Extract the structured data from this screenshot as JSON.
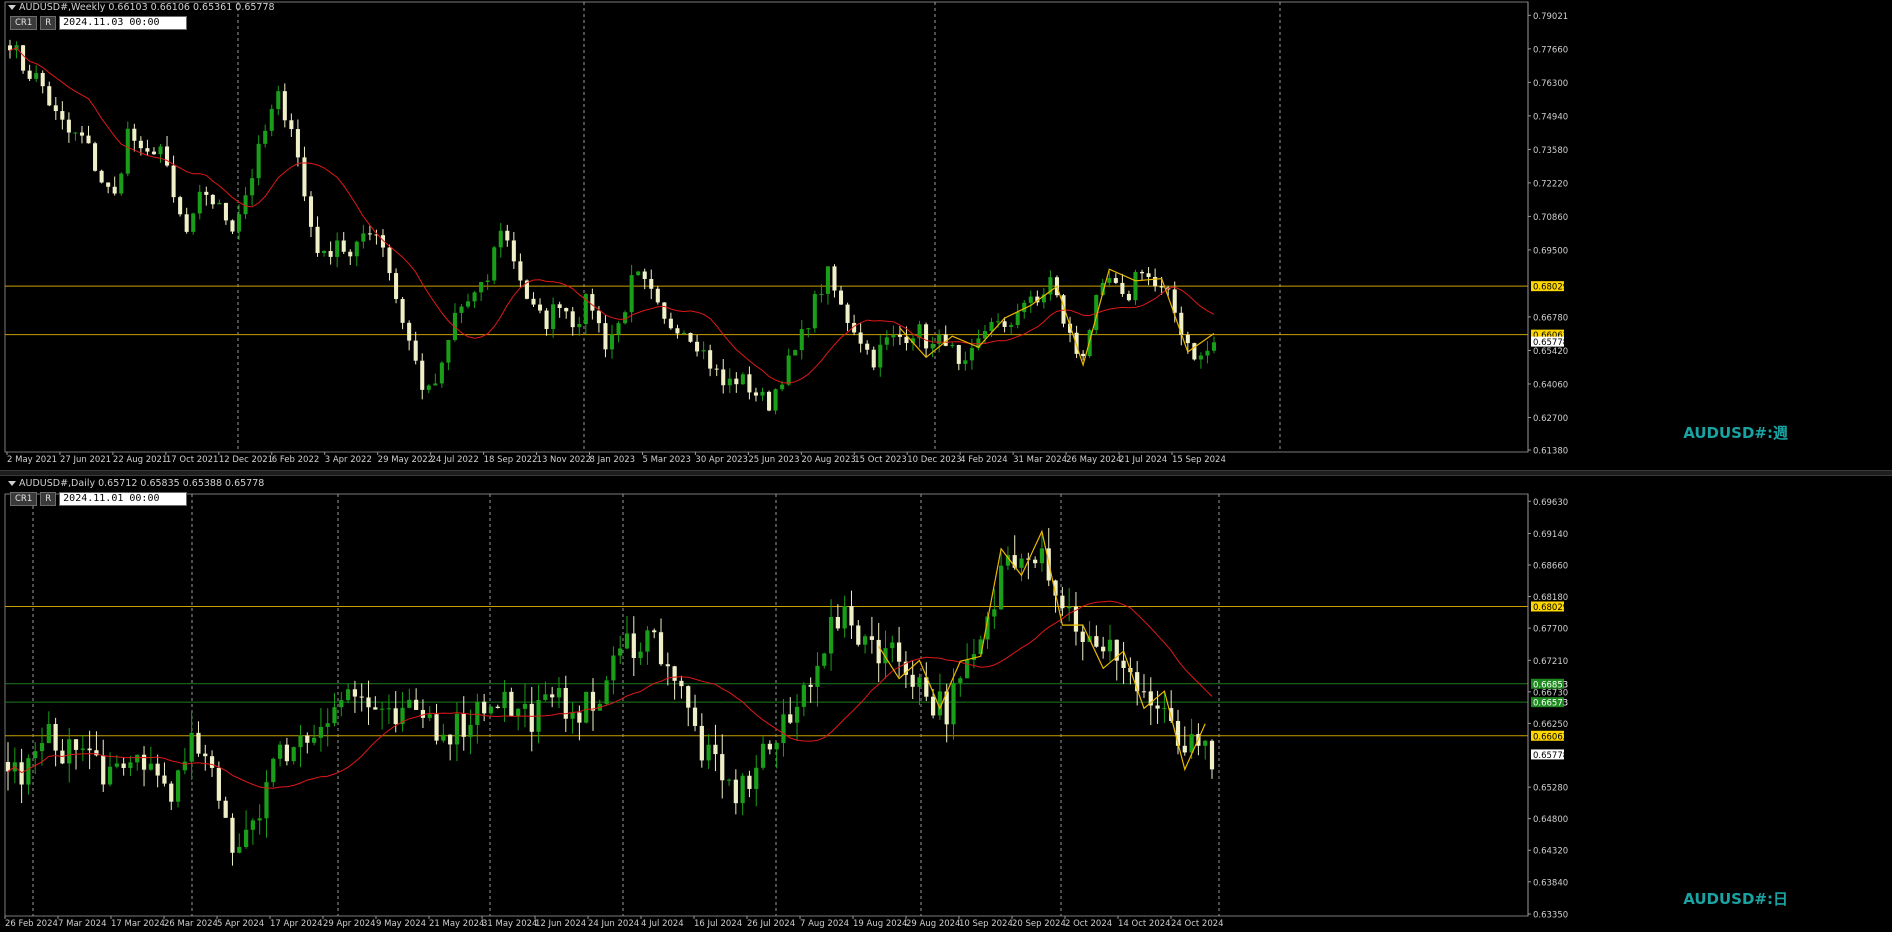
{
  "top": {
    "info": "AUDUSD#,Weekly  0.66103 0.66106 0.65361 0.65778",
    "btn1": "CR1",
    "btn2": "R",
    "date": "2024.11.03 00:00",
    "watermark": "AUDUSD#:週",
    "price_min": 0.6138,
    "price_max": 0.7948,
    "price_ticks": [
      "0.79021",
      "0.77660",
      "0.76300",
      "0.74940",
      "0.73580",
      "0.72220",
      "0.70860",
      "0.69500",
      "0.68029",
      "0.66780",
      "0.66062",
      "0.65778",
      "0.65420",
      "0.64060",
      "0.62700",
      "0.61380"
    ],
    "price_tick_values": [
      0.79021,
      0.7766,
      0.763,
      0.7494,
      0.7358,
      0.7222,
      0.7086,
      0.695,
      0.68029,
      0.6678,
      0.66062,
      0.65778,
      0.6542,
      0.6406,
      0.627,
      0.6138
    ],
    "hlines": [
      {
        "value": 0.68029,
        "label": "0.68029",
        "color": "#c8a000",
        "tag_bg": "#ffd700",
        "tag_fg": "#000000"
      },
      {
        "value": 0.66062,
        "label": "0.66062",
        "color": "#c8a000",
        "tag_bg": "#ffd700",
        "tag_fg": "#000000"
      }
    ],
    "last_price": {
      "value": 0.65778,
      "label": "0.65778"
    },
    "time_labels": [
      "2 May 2021",
      "27 Jun 2021",
      "22 Aug 2021",
      "17 Oct 2021",
      "12 Dec 2021",
      "6 Feb 2022",
      "3 Apr 2022",
      "29 May 2022",
      "24 Jul 2022",
      "18 Sep 2022",
      "13 Nov 2022",
      "8 Jan 2023",
      "5 Mar 2023",
      "30 Apr 2023",
      "25 Jun 2023",
      "20 Aug 2023",
      "15 Oct 2023",
      "10 Dec 2023",
      "4 Feb 2024",
      "31 Mar 2024",
      "26 May 2024",
      "21 Jul 2024",
      "15 Sep 2024"
    ],
    "anchors": [
      0.78,
      0.768,
      0.764,
      0.75,
      0.742,
      0.74,
      0.725,
      0.715,
      0.745,
      0.73,
      0.74,
      0.715,
      0.7,
      0.72,
      0.712,
      0.705,
      0.72,
      0.74,
      0.757,
      0.745,
      0.71,
      0.69,
      0.7,
      0.69,
      0.705,
      0.7,
      0.675,
      0.655,
      0.635,
      0.645,
      0.67,
      0.675,
      0.68,
      0.705,
      0.69,
      0.672,
      0.665,
      0.675,
      0.665,
      0.676,
      0.657,
      0.665,
      0.685,
      0.678,
      0.665,
      0.665,
      0.66,
      0.65,
      0.64,
      0.643,
      0.638,
      0.632,
      0.645,
      0.655,
      0.672,
      0.685,
      0.67,
      0.662,
      0.65,
      0.658,
      0.66,
      0.663,
      0.655,
      0.66,
      0.643,
      0.655,
      0.668,
      0.66,
      0.675,
      0.672,
      0.683,
      0.664,
      0.65,
      0.672,
      0.683,
      0.672,
      0.69,
      0.68,
      0.675,
      0.66,
      0.65,
      0.657
    ]
  },
  "bottom": {
    "info": "AUDUSD#,Daily  0.65712 0.65835 0.65388 0.65778",
    "btn1": "CR1",
    "btn2": "R",
    "date": "2024.11.01 00:00",
    "watermark": "AUDUSD#:日",
    "price_min": 0.6335,
    "price_max": 0.6971,
    "price_ticks": [
      "0.69630",
      "0.69140",
      "0.68660",
      "0.68180",
      "0.68029",
      "0.67700",
      "0.67210",
      "0.66853",
      "0.66730",
      "0.66573",
      "0.66250",
      "0.66062",
      "0.65778",
      "0.65280",
      "0.64800",
      "0.64320",
      "0.63840",
      "0.63350"
    ],
    "price_tick_values": [
      0.6963,
      0.6914,
      0.6866,
      0.6818,
      0.68029,
      0.677,
      0.6721,
      0.66853,
      0.6673,
      0.66573,
      0.6625,
      0.66062,
      0.65778,
      0.6528,
      0.648,
      0.6432,
      0.6384,
      0.6335
    ],
    "hlines": [
      {
        "value": 0.68029,
        "label": "0.68029",
        "color": "#c8a000",
        "tag_bg": "#ffd700",
        "tag_fg": "#000000"
      },
      {
        "value": 0.66853,
        "label": "0.66853",
        "color": "#1e7a1e",
        "tag_bg": "#1f8a1f",
        "tag_fg": "#ffffff"
      },
      {
        "value": 0.66573,
        "label": "0.66573",
        "color": "#1e7a1e",
        "tag_bg": "#1f8a1f",
        "tag_fg": "#ffffff"
      },
      {
        "value": 0.66062,
        "label": "0.66062",
        "color": "#c8a000",
        "tag_bg": "#ffd700",
        "tag_fg": "#000000"
      }
    ],
    "last_price": {
      "value": 0.65778,
      "label": "0.65778"
    },
    "time_labels": [
      "26 Feb 2024",
      "7 Mar 2024",
      "17 Mar 2024",
      "26 Mar 2024",
      "5 Apr 2024",
      "17 Apr 2024",
      "29 Apr 2024",
      "9 May 2024",
      "21 May 2024",
      "31 May 2024",
      "12 Jun 2024",
      "24 Jun 2024",
      "4 Jul 2024",
      "16 Jul 2024",
      "26 Jul 2024",
      "7 Aug 2024",
      "19 Aug 2024",
      "29 Aug 2024",
      "10 Sep 2024",
      "20 Sep 2024",
      "2 Oct 2024",
      "14 Oct 2024",
      "24 Oct 2024"
    ],
    "anchors": [
      0.655,
      0.655,
      0.66,
      0.659,
      0.658,
      0.656,
      0.653,
      0.658,
      0.654,
      0.653,
      0.66,
      0.652,
      0.644,
      0.648,
      0.655,
      0.66,
      0.66,
      0.665,
      0.667,
      0.666,
      0.662,
      0.663,
      0.664,
      0.662,
      0.662,
      0.665,
      0.667,
      0.664,
      0.664,
      0.665,
      0.666,
      0.664,
      0.67,
      0.675,
      0.676,
      0.673,
      0.665,
      0.658,
      0.653,
      0.652,
      0.658,
      0.66,
      0.665,
      0.673,
      0.678,
      0.677,
      0.675,
      0.673,
      0.671,
      0.666,
      0.665,
      0.67,
      0.676,
      0.688,
      0.69,
      0.689,
      0.681,
      0.677,
      0.672,
      0.674,
      0.668,
      0.665,
      0.66,
      0.658,
      0.657
    ]
  },
  "colors": {
    "bg": "#000000",
    "bull": "#1a9e1a",
    "bear": "#f0f0c8",
    "ma": "#e01818",
    "zigzag": "#e8b800",
    "grid": "#9a9a9a",
    "axis_text": "#cfcfcf"
  }
}
